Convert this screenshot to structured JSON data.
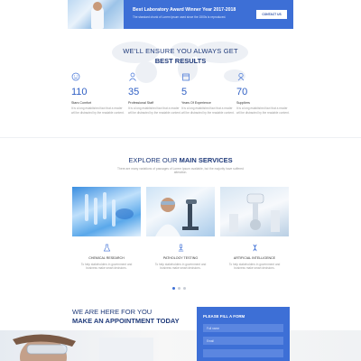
{
  "banner": {
    "title": "Best Laboratory Award Winner Year 2017-2018",
    "subtitle": "The standard chunk of Lorem Ipsum used since the 1500s is reproduced.",
    "button_label": "CONTACT US"
  },
  "results": {
    "heading": "WE'LL ENSURE YOU ALWAYS GET",
    "heading_strong": "BEST RESULTS",
    "stats": [
      {
        "icon": "happy-face-icon",
        "number": "110",
        "label": "Stars Comfort",
        "text": "It is a long established fact that a reader will be distracted by the readable content."
      },
      {
        "icon": "staff-person-icon",
        "number": "35",
        "label": "Professional Staff",
        "text": "It is a long established fact that a reader will be distracted by the readable content."
      },
      {
        "icon": "calendar-icon",
        "number": "5",
        "label": "Years Of Experience",
        "text": "It is a long established fact that a reader will be distracted by the readable content."
      },
      {
        "icon": "supplier-icon",
        "number": "70",
        "label": "Suppliers",
        "text": "It is a long established fact that a reader will be distracted by the readable content."
      }
    ]
  },
  "services": {
    "heading": "EXPLORE OUR",
    "heading_strong": "MAIN SERVICES",
    "intro": "There are many variations of passages of Lorem Ipsum available, but the majority have suffered alteration.",
    "cards": [
      {
        "icon": "flask-icon",
        "title": "CHEMICAL RESEARCH",
        "text": "To help stakeholders in government and business make smart decisions."
      },
      {
        "icon": "microscope-icon",
        "title": "PATHOLOGY TESTING",
        "text": "To help stakeholders in government and business make smart decisions."
      },
      {
        "icon": "dna-icon",
        "title": "ARTIFICIAL INTELLIGENCE",
        "text": "To help stakeholders in government and business make smart decisions."
      }
    ],
    "carousel_active": 1
  },
  "appointment": {
    "line1": "WE ARE HERE FOR YOU",
    "line2": "MAKE AN APPOINTMENT TODAY",
    "form_title": "PLEASE FILL A FORM",
    "name_placeholder": "Full name",
    "email_placeholder": "Email"
  },
  "colors": {
    "accent": "#3d6fd6",
    "heading": "#1f3a7a",
    "muted_text": "#999999"
  }
}
